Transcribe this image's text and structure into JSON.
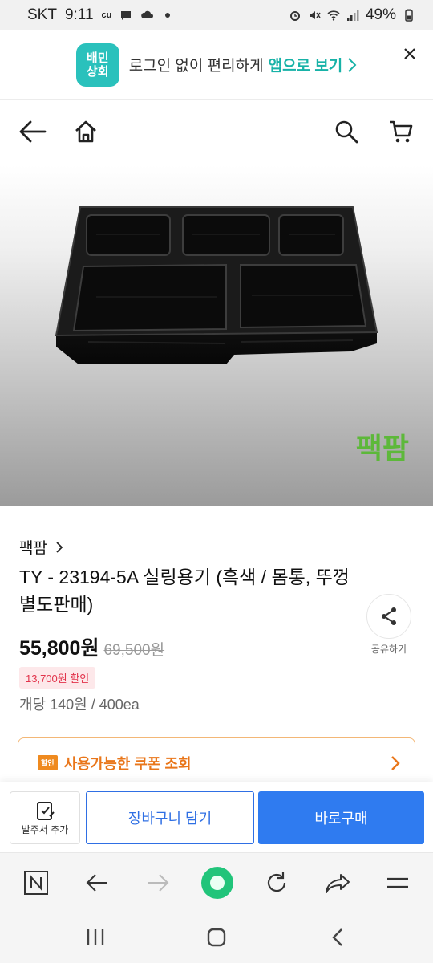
{
  "status_bar": {
    "carrier": "SKT",
    "time": "9:11",
    "indicator": "cu",
    "battery": "49%",
    "icons": [
      "chat-icon",
      "cloud-icon",
      "dot-icon",
      "alarm-icon",
      "mute-icon",
      "wifi-icon",
      "signal-icon",
      "battery-icon"
    ]
  },
  "app_banner": {
    "logo_line1": "배민",
    "logo_line2": "상회",
    "message": "로그인 없이 편리하게",
    "link": "앱으로 보기",
    "accent_color": "#17b2a7"
  },
  "header": {
    "icons": [
      "back-arrow-icon",
      "home-icon",
      "search-icon",
      "cart-icon"
    ]
  },
  "product_image": {
    "brand_watermark": "팩팜"
  },
  "product": {
    "seller": "팩팜",
    "title": "TY - 23194-5A 실링용기 (흑색 / 몸통, 뚜껑 별도판매)",
    "share_label": "공유하기",
    "price": "55,800원",
    "original_price": "69,500원",
    "discount": "13,700원 할인",
    "unit_price": "개당 140원 / 400ea",
    "coupon_tag": "할인",
    "coupon_text": "사용가능한 쿠폰 조회",
    "coupon_color": "#e9761a"
  },
  "actions": {
    "order_label": "발주서 추가",
    "cart_label": "장바구니 담기",
    "buy_label": "바로구매",
    "primary_color": "#2f7bf0"
  },
  "browser_toolbar": {
    "icons": [
      "naver-n-icon",
      "back-arrow-icon",
      "forward-arrow-icon",
      "naver-green-dot-icon",
      "refresh-icon",
      "share-arrow-icon",
      "menu-icon"
    ]
  },
  "system_nav": {
    "icons": [
      "recent-apps-icon",
      "home-circle-icon",
      "back-chevron-icon"
    ]
  }
}
